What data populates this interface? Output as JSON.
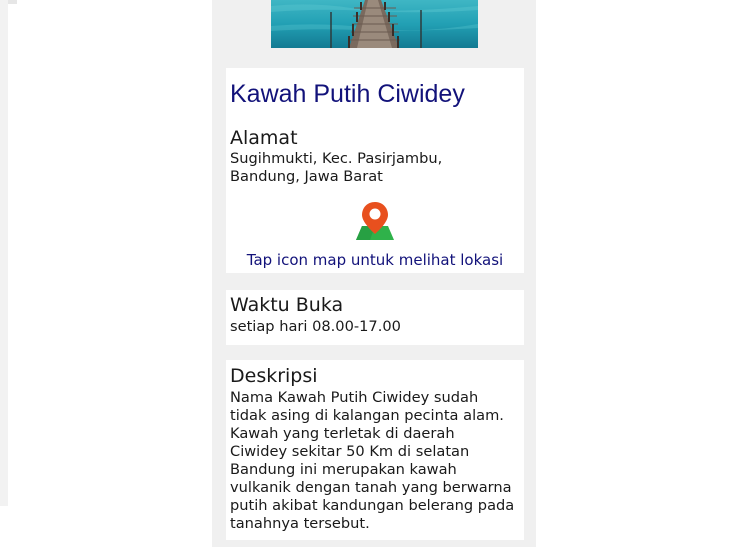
{
  "hero": {
    "icon": "pier-over-lake-photo"
  },
  "place": {
    "title": "Kawah Putih Ciwidey"
  },
  "address": {
    "label": "Alamat",
    "value": "Sugihmukti, Kec. Pasirjambu, Bandung, Jawa Barat"
  },
  "map": {
    "icon": "map-pin-icon",
    "hint": "Tap icon map untuk melihat lokasi",
    "pin_color": "#e8501e",
    "land_color": "#2fb24a"
  },
  "hours": {
    "label": "Waktu Buka",
    "value": "setiap hari 08.00-17.00"
  },
  "description": {
    "label": "Deskripsi",
    "value": "Nama Kawah Putih Ciwidey sudah tidak asing di kalangan pecinta alam. Kawah yang terletak di daerah Ciwidey sekitar 50 Km di selatan Bandung ini merupakan kawah vulkanik dengan tanah yang berwarna putih akibat kandungan belerang pada tanahnya tersebut."
  },
  "colors": {
    "title": "#12127a",
    "page_background": "#f0f0f0",
    "card_background": "#ffffff"
  }
}
